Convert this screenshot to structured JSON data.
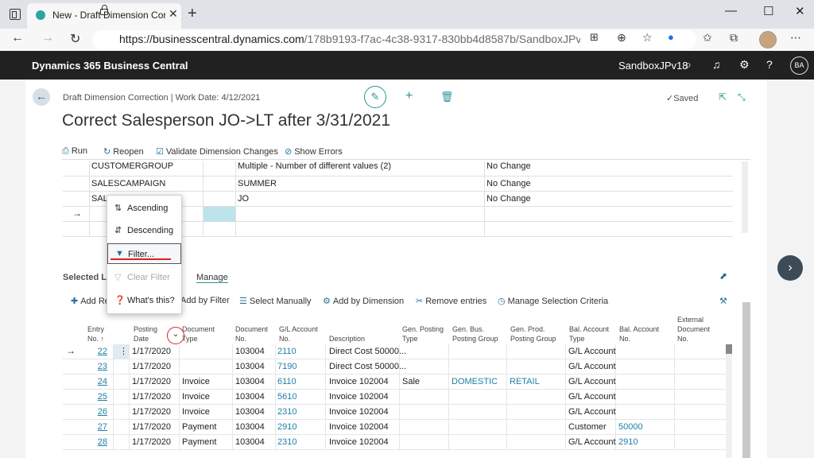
{
  "browser": {
    "tab_title": "New - Draft Dimension Correctio",
    "url_main": "https://businesscentral.dynamics.com",
    "url_rest": "/178b9193-f7ac-4c38-9317-830bb4d8587b/SandboxJPv18?co..."
  },
  "bc": {
    "brand": "Dynamics 365 Business Central",
    "environment": "SandboxJPv18",
    "avatar": "BA"
  },
  "page": {
    "breadcrumb": "Draft Dimension Correction | Work Date: 4/12/2021",
    "saved": "✓Saved",
    "title": "Correct Salesperson JO->LT after 3/31/2021"
  },
  "actions": {
    "run": "Run",
    "reopen": "Reopen",
    "validate": "Validate Dimension Changes",
    "show_errors": "Show Errors"
  },
  "upper_rows": [
    {
      "code": "CUSTOMERGROUP",
      "value": "Multiple - Number of different values (2)",
      "change": "No Change"
    },
    {
      "code": "SALESCAMPAIGN",
      "value": "SUMMER",
      "change": "No Change"
    },
    {
      "code": "SALESPERSON",
      "value": "JO",
      "change": "No Change"
    }
  ],
  "context_menu": {
    "ascending": "Ascending",
    "descending": "Descending",
    "filter": "Filter...",
    "clear_filter": "Clear Filter",
    "whats_this": "What's this?"
  },
  "section": {
    "label": "Selected Le",
    "manage": "Manage"
  },
  "actions2": {
    "add_re": "Add Re",
    "add_by_filter": "Add by Filter",
    "select_manually": "Select Manually",
    "add_by_dimension": "Add by Dimension",
    "remove_entries": "Remove entries",
    "manage_selection": "Manage Selection Criteria"
  },
  "columns": {
    "entry_no": [
      "Entry",
      "No. ↑"
    ],
    "posting_date": [
      "Posting",
      "Date"
    ],
    "doc_type": [
      "Document",
      "Type"
    ],
    "doc_no": [
      "Document",
      "No."
    ],
    "gl_account": [
      "G/L Account",
      "No."
    ],
    "description": [
      "Description"
    ],
    "gen_posting_type": [
      "Gen. Posting",
      "Type"
    ],
    "gen_bus": [
      "Gen. Bus.",
      "Posting Group"
    ],
    "gen_prod": [
      "Gen. Prod.",
      "Posting Group"
    ],
    "bal_type": [
      "Bal. Account",
      "Type"
    ],
    "bal_no": [
      "Bal. Account",
      "No."
    ],
    "ext_doc": [
      "External",
      "Document",
      "No."
    ]
  },
  "rows": [
    {
      "entry": "22",
      "date": "1/17/2020",
      "doc_type": "",
      "doc_no": "103004",
      "gl": "2110",
      "desc": "Direct Cost 50000...",
      "gpt": "",
      "gbus": "",
      "gprod": "",
      "bal_type": "G/L Account",
      "bal_no": ""
    },
    {
      "entry": "23",
      "date": "1/17/2020",
      "doc_type": "",
      "doc_no": "103004",
      "gl": "7190",
      "desc": "Direct Cost 50000...",
      "gpt": "",
      "gbus": "",
      "gprod": "",
      "bal_type": "G/L Account",
      "bal_no": ""
    },
    {
      "entry": "24",
      "date": "1/17/2020",
      "doc_type": "Invoice",
      "doc_no": "103004",
      "gl": "6110",
      "desc": "Invoice 102004",
      "gpt": "Sale",
      "gbus": "DOMESTIC",
      "gprod": "RETAIL",
      "bal_type": "G/L Account",
      "bal_no": ""
    },
    {
      "entry": "25",
      "date": "1/17/2020",
      "doc_type": "Invoice",
      "doc_no": "103004",
      "gl": "5610",
      "desc": "Invoice 102004",
      "gpt": "",
      "gbus": "",
      "gprod": "",
      "bal_type": "G/L Account",
      "bal_no": ""
    },
    {
      "entry": "26",
      "date": "1/17/2020",
      "doc_type": "Invoice",
      "doc_no": "103004",
      "gl": "2310",
      "desc": "Invoice 102004",
      "gpt": "",
      "gbus": "",
      "gprod": "",
      "bal_type": "G/L Account",
      "bal_no": ""
    },
    {
      "entry": "27",
      "date": "1/17/2020",
      "doc_type": "Payment",
      "doc_no": "103004",
      "gl": "2910",
      "desc": "Invoice 102004",
      "gpt": "",
      "gbus": "",
      "gprod": "",
      "bal_type": "Customer",
      "bal_no": "50000"
    },
    {
      "entry": "28",
      "date": "1/17/2020",
      "doc_type": "Payment",
      "doc_no": "103004",
      "gl": "2310",
      "desc": "Invoice 102004",
      "gpt": "",
      "gbus": "",
      "gprod": "",
      "bal_type": "G/L Account",
      "bal_no": "2910"
    }
  ]
}
